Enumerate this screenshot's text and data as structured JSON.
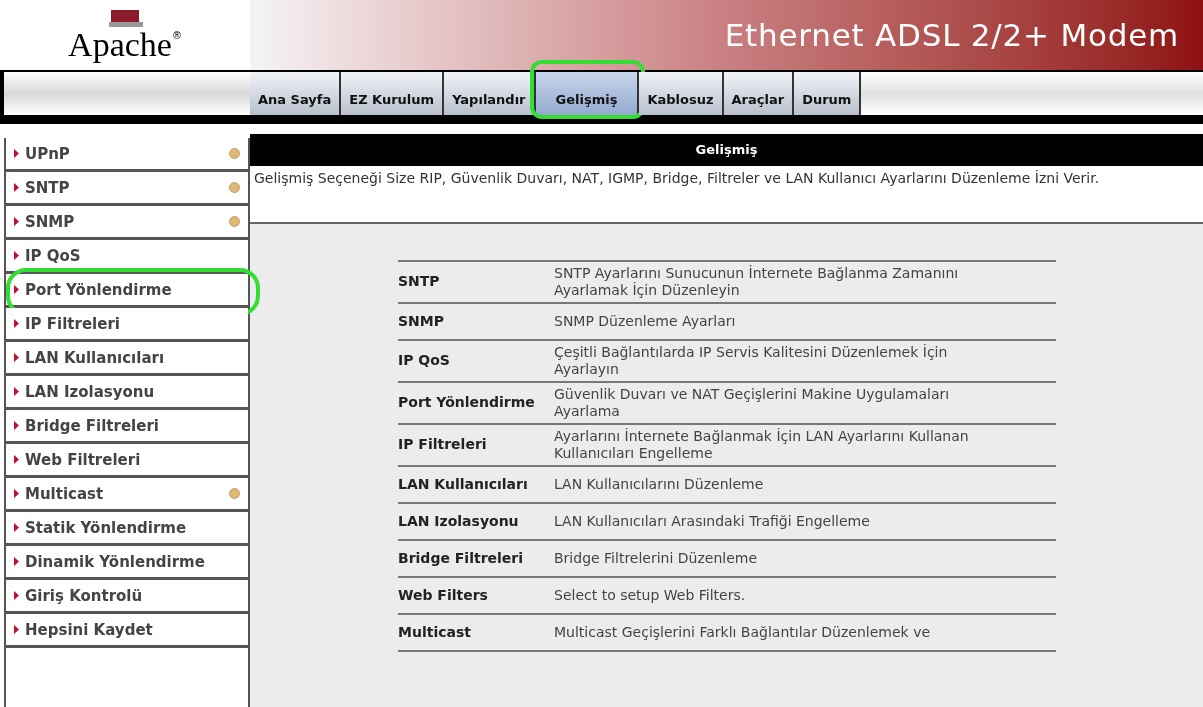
{
  "header": {
    "logo": "Apache",
    "logo_mark": "®",
    "title": "Ethernet ADSL 2/2+ Modem"
  },
  "tabs": [
    {
      "label": "Ana Sayfa",
      "selected": false,
      "highlighted": false
    },
    {
      "label": "EZ Kurulum",
      "selected": false,
      "highlighted": false
    },
    {
      "label": "Yapılandır",
      "selected": false,
      "highlighted": false
    },
    {
      "label": "Gelişmiş",
      "selected": true,
      "highlighted": true
    },
    {
      "label": "Kablosuz",
      "selected": false,
      "highlighted": false
    },
    {
      "label": "Araçlar",
      "selected": false,
      "highlighted": false
    },
    {
      "label": "Durum",
      "selected": false,
      "highlighted": false
    }
  ],
  "sidebar": {
    "items": [
      {
        "label": "UPnP",
        "has_dot": true,
        "highlighted": false
      },
      {
        "label": "SNTP",
        "has_dot": true,
        "highlighted": false
      },
      {
        "label": "SNMP",
        "has_dot": true,
        "highlighted": false
      },
      {
        "label": "IP QoS",
        "has_dot": false,
        "highlighted": false
      },
      {
        "label": "Port Yönlendirme",
        "has_dot": false,
        "highlighted": true
      },
      {
        "label": "IP Filtreleri",
        "has_dot": false,
        "highlighted": false
      },
      {
        "label": "LAN Kullanıcıları",
        "has_dot": false,
        "highlighted": false
      },
      {
        "label": "LAN Izolasyonu",
        "has_dot": false,
        "highlighted": false
      },
      {
        "label": "Bridge Filtreleri",
        "has_dot": false,
        "highlighted": false
      },
      {
        "label": "Web Filtreleri",
        "has_dot": false,
        "highlighted": false
      },
      {
        "label": "Multicast",
        "has_dot": true,
        "highlighted": false
      },
      {
        "label": "Statik Yönlendirme",
        "has_dot": false,
        "highlighted": false
      },
      {
        "label": "Dinamik Yönlendirme",
        "has_dot": false,
        "highlighted": false
      },
      {
        "label": "Giriş Kontrolü",
        "has_dot": false,
        "highlighted": false
      },
      {
        "label": "Hepsini Kaydet",
        "has_dot": false,
        "highlighted": false
      }
    ]
  },
  "section": {
    "title": "Gelişmiş",
    "description": "Gelişmiş Seçeneği Size RIP, Güvenlik Duvarı, NAT, IGMP, Bridge, Filtreler ve LAN Kullanıcı Ayarlarını Düzenleme İzni Verir."
  },
  "table": {
    "rows": [
      {
        "name": "SNTP",
        "description": "SNTP Ayarlarını Sunucunun İnternete Bağlanma Zamanını Ayarlamak İçin Düzenleyin"
      },
      {
        "name": "SNMP",
        "description": "SNMP Düzenleme Ayarları"
      },
      {
        "name": "IP QoS",
        "description": "Çeşitli Bağlantılarda IP Servis Kalitesini Düzenlemek İçin Ayarlayın"
      },
      {
        "name": "Port Yönlendirme",
        "description": "Güvenlik Duvarı ve NAT Geçişlerini Makine Uygulamaları Ayarlama"
      },
      {
        "name": "IP Filtreleri",
        "description": "Ayarlarını İnternete Bağlanmak İçin LAN Ayarlarını Kullanan Kullanıcıları Engelleme"
      },
      {
        "name": "LAN Kullanıcıları",
        "description": "LAN Kullanıcılarını Düzenleme"
      },
      {
        "name": "LAN Izolasyonu",
        "description": "LAN Kullanıcıları Arasındaki Trafiği Engelleme"
      },
      {
        "name": "Bridge Filtreleri",
        "description": "Bridge Filtrelerini Düzenleme"
      },
      {
        "name": "Web Filters",
        "description": "Select to setup Web Filters."
      },
      {
        "name": "Multicast",
        "description": "Multicast Geçişlerini Farklı Bağlantılar Düzenlemek ve"
      }
    ]
  }
}
